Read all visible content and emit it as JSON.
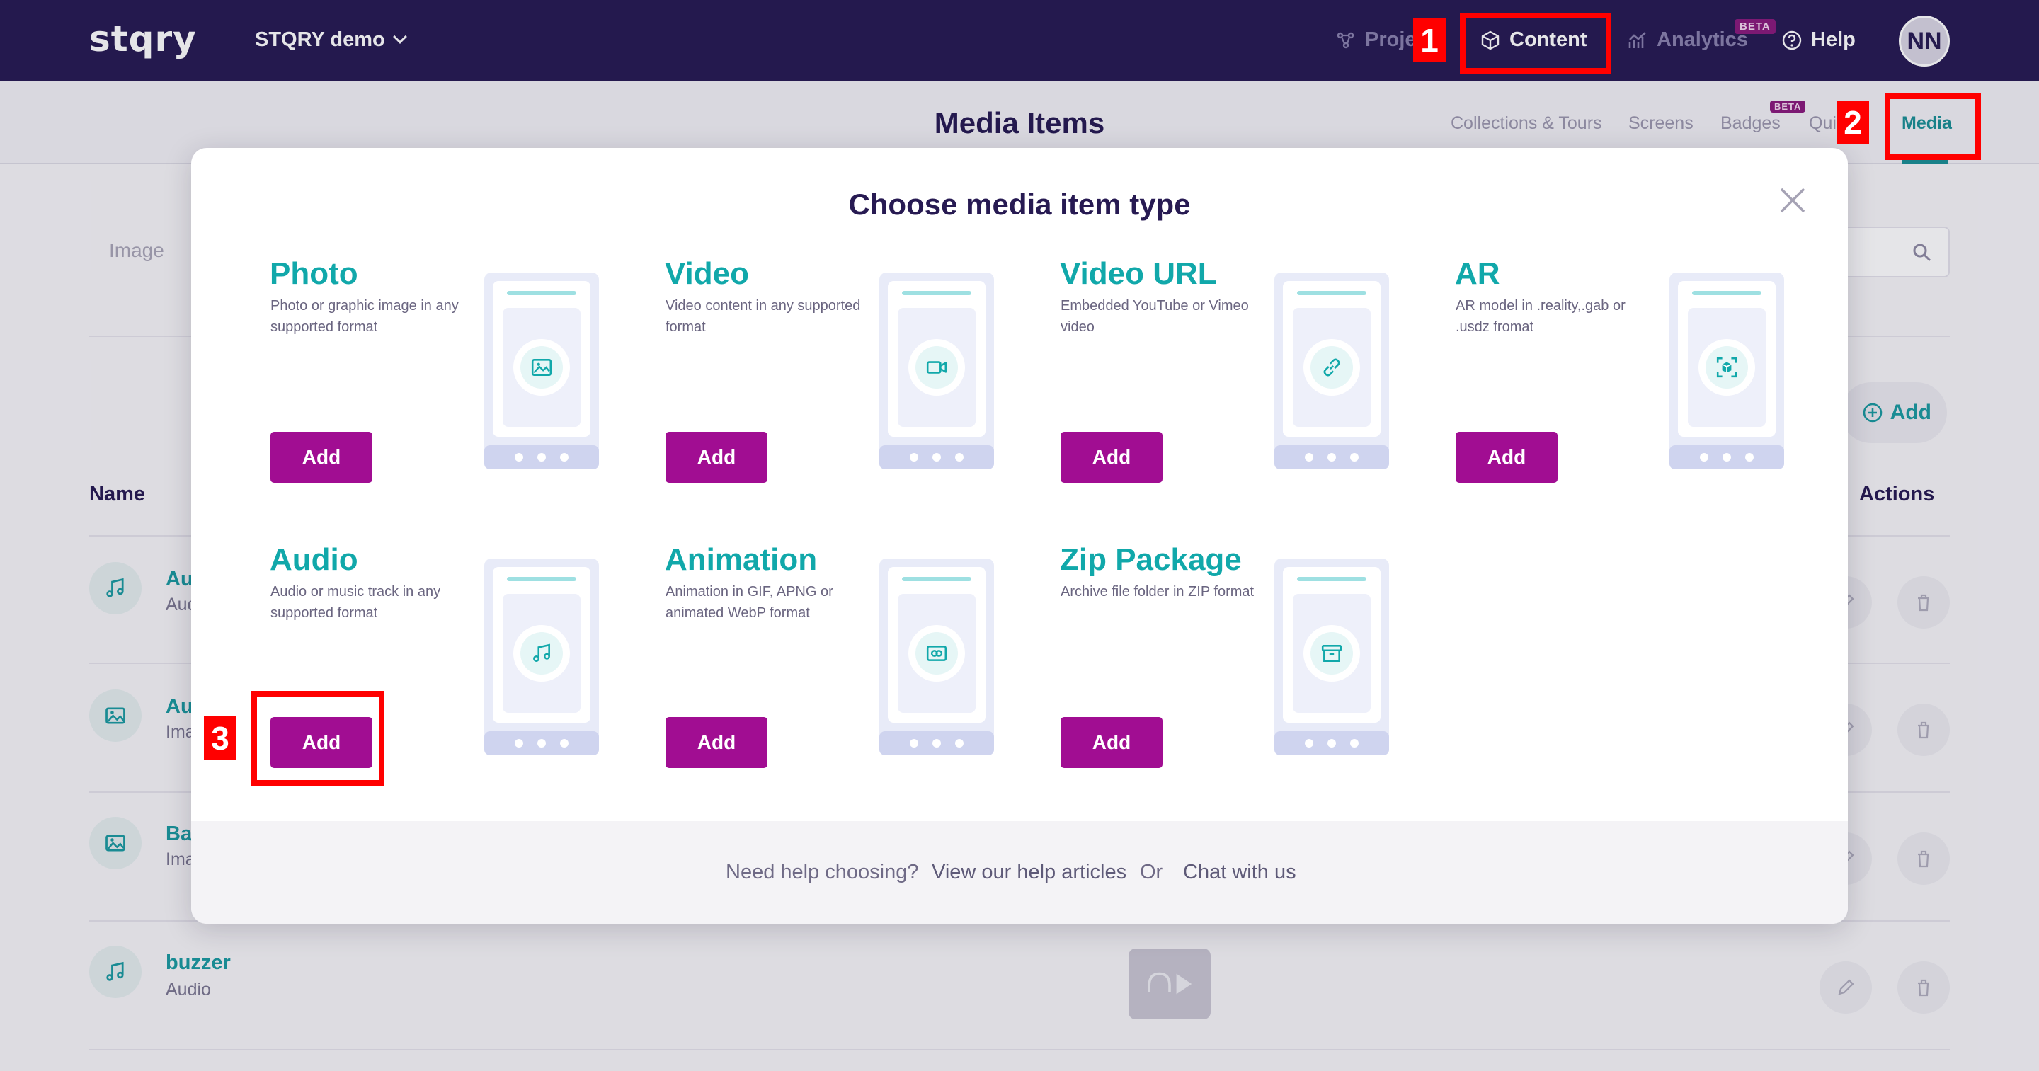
{
  "app": {
    "logo": "stqry",
    "project_name": "STQRY demo",
    "nav": {
      "projects": "Projects",
      "content": "Content",
      "analytics": "Analytics",
      "help": "Help",
      "beta": "BETA"
    },
    "user_initials": "NN"
  },
  "subheader": {
    "title": "Media Items",
    "tabs": [
      "Collections & Tours",
      "Screens",
      "Badges",
      "Quizzes",
      "Media"
    ],
    "active_tab": "Media"
  },
  "background": {
    "filter_label": "Image",
    "add_label": "Add",
    "columns": {
      "name": "Name",
      "actions": "Actions"
    },
    "rows": [
      {
        "name": "Au",
        "type": "Aud",
        "icon": "music-note-icon"
      },
      {
        "name": "Au",
        "type": "Ima",
        "icon": "image-icon"
      },
      {
        "name": "Bac",
        "type": "Ima",
        "icon": "image-icon"
      },
      {
        "name": "buzzer",
        "type": "Audio",
        "icon": "music-note-icon"
      }
    ]
  },
  "modal": {
    "title": "Choose media item type",
    "add_label": "Add",
    "types": [
      {
        "title": "Photo",
        "description": "Photo or graphic image in any supported format",
        "icon": "image-icon"
      },
      {
        "title": "Video",
        "description": "Video content in any supported format",
        "icon": "video-camera-icon"
      },
      {
        "title": "Video URL",
        "description": "Embedded YouTube or Vimeo video",
        "icon": "link-icon"
      },
      {
        "title": "AR",
        "description": "AR model in .reality,.gab or .usdz fromat",
        "icon": "ar-cube-icon"
      },
      {
        "title": "Audio",
        "description": "Audio or music track in any supported format",
        "icon": "music-note-icon"
      },
      {
        "title": "Animation",
        "description": "Animation in GIF, APNG or animated WebP format",
        "icon": "animation-icon"
      },
      {
        "title": "Zip Package",
        "description": "Archive file folder in ZIP format",
        "icon": "archive-box-icon"
      }
    ],
    "footer": {
      "need_help": "Need help choosing?",
      "help_articles": "View our help articles",
      "or": "Or",
      "chat": "Chat with us"
    }
  },
  "annotations": [
    "1",
    "2",
    "3"
  ],
  "colors": {
    "nav_bg": "#271a52",
    "accent_teal": "#11a8aa",
    "button_magenta": "#a10d92",
    "annotation_red": "#ff0000"
  }
}
